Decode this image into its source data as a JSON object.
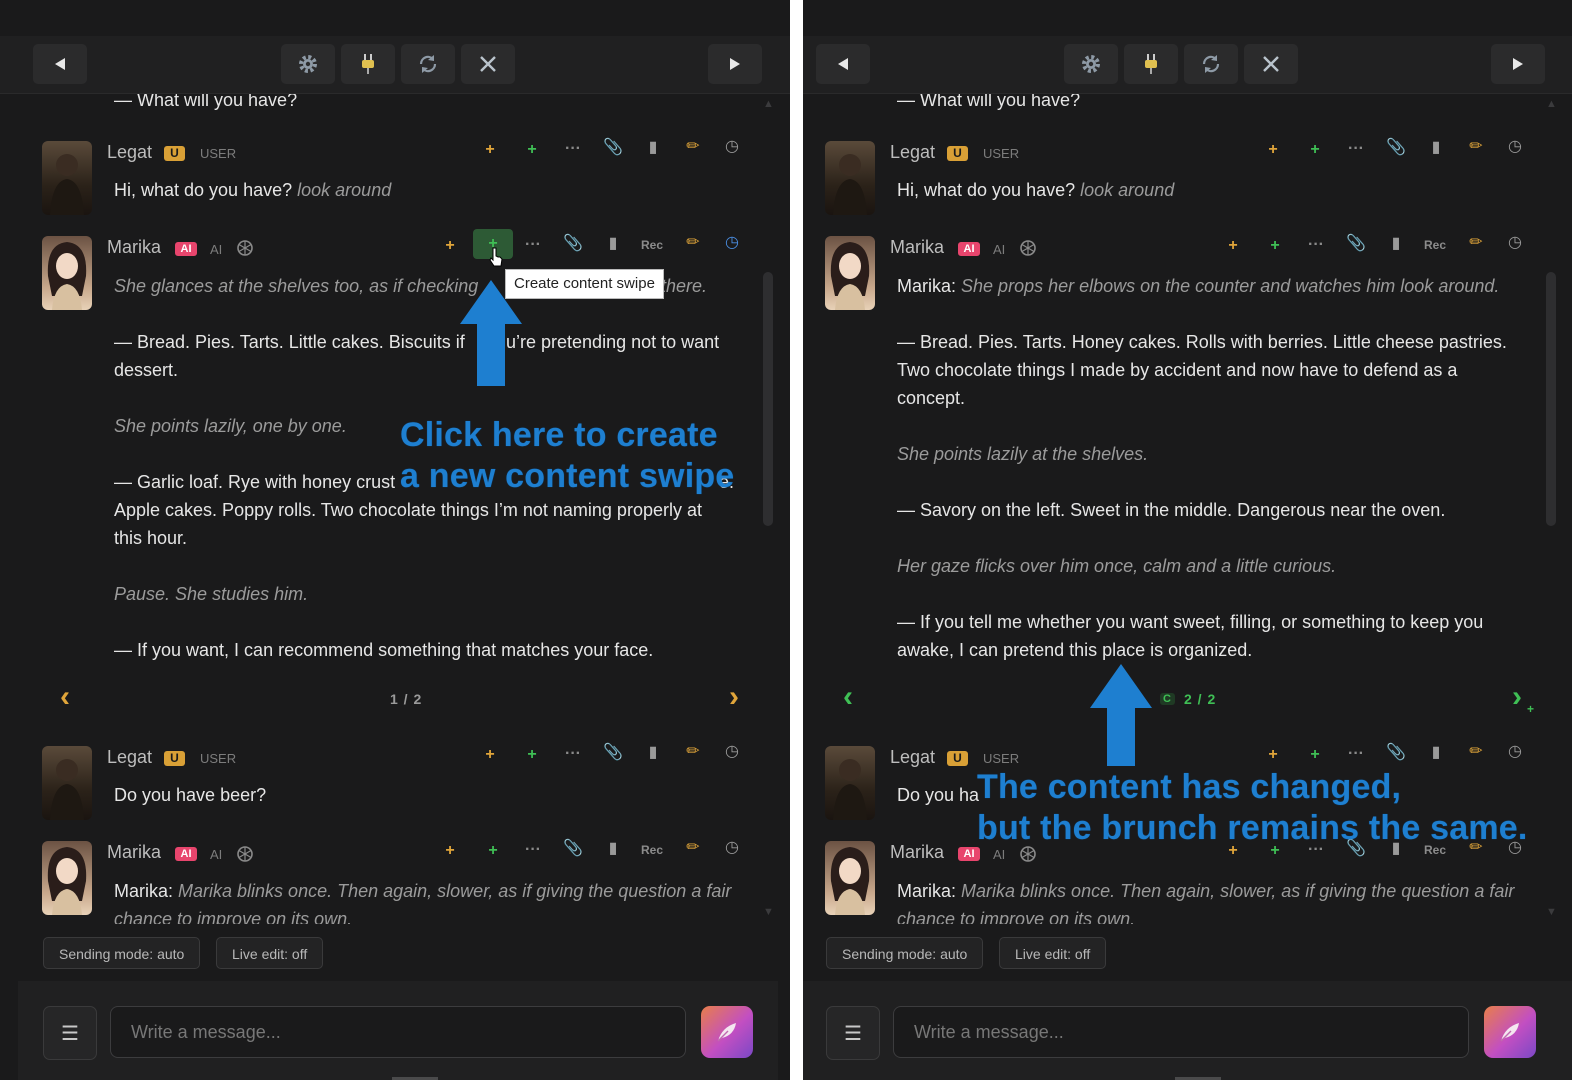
{
  "toolbar": {
    "prev_icon": "triangle-left-icon",
    "settings_icon": "gear-icon",
    "plugin_icon": "plug-icon",
    "refresh_icon": "refresh-icon",
    "close_icon": "close-icon",
    "next_icon": "triangle-right-icon"
  },
  "left": {
    "top_fragment": "— What will you have?",
    "msg1": {
      "name": "Legat",
      "badge": "U",
      "role": "USER",
      "text": "Hi, what do you have?",
      "action": "look around"
    },
    "msg2": {
      "name": "Marika",
      "badge": "AI",
      "role": "AI",
      "rec": "Rec",
      "lines": [
        {
          "text": "She glances at the shelves too, as if checking",
          "tail": "there.",
          "italic": true
        },
        {
          "text": "— Bread. Pies. Tarts. Little cakes. Biscuits if",
          "tail": "u’re pretending not to want",
          "italic": false
        },
        {
          "text": "dessert.",
          "italic": false
        },
        {
          "text": "She points lazily, one by one.",
          "italic": true
        },
        {
          "text": "— Garlic loaf. Rye with honey crust",
          "tail": "e.",
          "italic": false
        },
        {
          "text": "Apple cakes. Poppy rolls. Two chocolate things I’m not naming properly at",
          "italic": false
        },
        {
          "text": "this hour.",
          "italic": false
        },
        {
          "text": "Pause. She studies him.",
          "italic": true
        },
        {
          "text": "— If you want, I can recommend something that matches your face.",
          "italic": false
        }
      ],
      "pager": "1 / 2"
    },
    "msg3": {
      "name": "Legat",
      "badge": "U",
      "role": "USER",
      "text": "Do you have beer?"
    },
    "msg4": {
      "name": "Marika",
      "badge": "AI",
      "role": "AI",
      "rec": "Rec",
      "speaker": "Marika:",
      "line1": "Marika blinks once. Then again, slower, as if giving the question a fair",
      "line2": "chance to improve on its own."
    },
    "tooltip": "Create content swipe",
    "annotation_line1": "Click here to create",
    "annotation_line2": "a new content swipe"
  },
  "right": {
    "top_fragment": "— What will you have?",
    "msg1": {
      "name": "Legat",
      "badge": "U",
      "role": "USER",
      "text": "Hi, what do you have?",
      "action": "look around"
    },
    "msg2": {
      "name": "Marika",
      "badge": "AI",
      "role": "AI",
      "rec": "Rec",
      "speaker": "Marika:",
      "first_line": "She props her elbows on the counter and watches him look around.",
      "lines": [
        {
          "text": "— Bread. Pies. Tarts. Honey cakes. Rolls with berries. Little cheese pastries.",
          "italic": false
        },
        {
          "text": "Two chocolate things I made by accident and now have to defend as a",
          "italic": false
        },
        {
          "text": "concept.",
          "italic": false
        },
        {
          "text": "She points lazily at the shelves.",
          "italic": true
        },
        {
          "text": "— Savory on the left. Sweet in the middle. Dangerous near the oven.",
          "italic": false
        },
        {
          "text": "Her gaze flicks over him once, calm and a little curious.",
          "italic": true
        },
        {
          "text": "— If you tell me whether you want sweet, filling, or something to keep you",
          "italic": false
        },
        {
          "text": "awake, I can pretend this place is organized.",
          "italic": false
        }
      ],
      "pager_prefix": "C",
      "pager": "2 / 2"
    },
    "msg3": {
      "name": "Legat",
      "badge": "U",
      "role": "USER",
      "text": "Do you ha"
    },
    "msg4": {
      "name": "Marika",
      "badge": "AI",
      "role": "AI",
      "rec": "Rec",
      "speaker": "Marika:",
      "line1": "Marika blinks once. Then again, slower, as if giving the question a fair",
      "line2": "chance to improve on its own."
    },
    "annotation_line1": "The content has changed,",
    "annotation_line2": "but the brunch remains the same."
  },
  "footer": {
    "sending_mode": "Sending mode: auto",
    "live_edit": "Live edit: off",
    "input_placeholder": "Write a message...",
    "menu_icon": "hamburger-icon",
    "send_icon": "feather-icon"
  },
  "colors": {
    "background": "#1a1a1b",
    "accent_orange": "#e0a53a",
    "accent_green": "#3fbf55",
    "badge_ai": "#e8456d",
    "annotation_blue": "#1e7fd0"
  }
}
